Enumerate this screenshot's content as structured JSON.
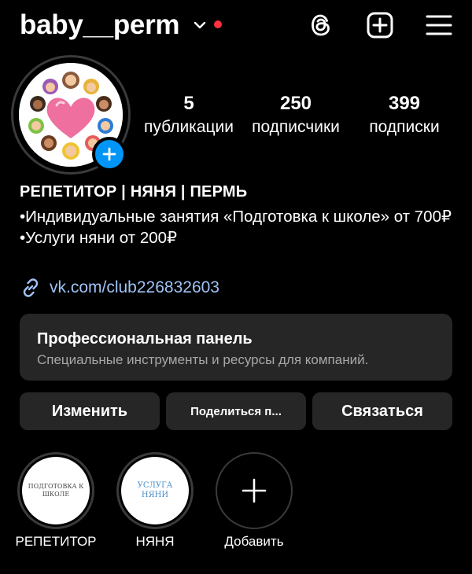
{
  "header": {
    "username": "baby__perm",
    "icons": [
      "chevron-down-icon",
      "notification-dot",
      "threads-icon",
      "add-post-icon",
      "menu-icon"
    ],
    "accent_dot_color": "#ff3040"
  },
  "profile": {
    "avatar": "profile-avatar-illustration",
    "stats": [
      {
        "value": "5",
        "label": "публикации"
      },
      {
        "value": "250",
        "label": "подписчики"
      },
      {
        "value": "399",
        "label": "подписки"
      }
    ]
  },
  "bio": {
    "name": "РЕПЕТИТОР | НЯНЯ | ПЕРМЬ",
    "line1": "•Индивидуальные занятия «Подготовка к школе» от 700₽",
    "line2": "•Услуги няни от 200₽",
    "link": "vk.com/club226832603",
    "link_color": "#9fc3f5"
  },
  "pro_panel": {
    "title": "Профессиональная панель",
    "subtitle": "Специальные инструменты и ресурсы для компаний."
  },
  "buttons": {
    "edit": "Изменить",
    "share": "Поделиться п...",
    "contact": "Связаться"
  },
  "highlights": [
    {
      "label": "РЕПЕТИТОР",
      "cover_line1": "ПОДГОТОВКА К",
      "cover_line2": "ШКОЛЕ"
    },
    {
      "label": "НЯНЯ",
      "cover_line1": "УСЛУГА",
      "cover_line2": "НЯНИ"
    },
    {
      "label": "Добавить"
    }
  ],
  "colors": {
    "background": "#000000",
    "panel": "#262626",
    "primary_blue": "#0095f6"
  }
}
